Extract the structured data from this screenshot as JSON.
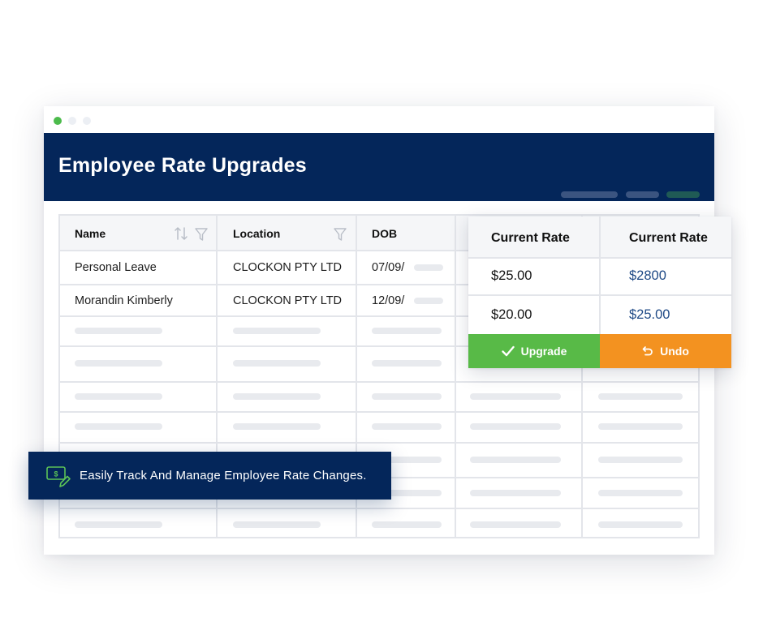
{
  "window": {
    "title": "Employee Rate Upgrades"
  },
  "table": {
    "columns": [
      {
        "label": "Name"
      },
      {
        "label": "Location"
      },
      {
        "label": "DOB"
      }
    ],
    "rows": [
      {
        "name": "Personal Leave",
        "location": "CLOCKON PTY LTD",
        "dob": "07/09/"
      },
      {
        "name": "Morandin Kimberly",
        "location": "CLOCKON PTY LTD",
        "dob": "12/09/"
      }
    ]
  },
  "rate_card": {
    "headers": [
      "Current Rate",
      "Current Rate"
    ],
    "rows": [
      {
        "current": "$25.00",
        "new": "$2800"
      },
      {
        "current": "$20.00",
        "new": "$25.00"
      }
    ],
    "upgrade_label": "Upgrade",
    "undo_label": "Undo"
  },
  "banner": {
    "text": "Easily Track And Manage Employee Rate Changes."
  },
  "colors": {
    "brand_navy": "#04265a",
    "upgrade_green": "#58ba47",
    "undo_orange": "#f39220",
    "link_blue": "#1f4a86",
    "window_dot_green": "#4cbb4c"
  },
  "icons": {
    "sort": "sort-icon",
    "filter": "filter-icon",
    "check": "check-icon",
    "undo": "undo-icon",
    "money_edit": "money-edit-icon"
  }
}
